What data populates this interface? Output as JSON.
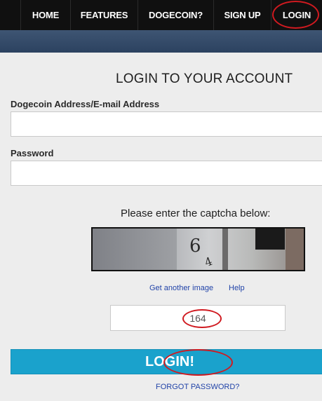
{
  "nav": {
    "items": [
      {
        "label": "HOME"
      },
      {
        "label": "FEATURES"
      },
      {
        "label": "DOGECOIN?"
      },
      {
        "label": "SIGN UP"
      },
      {
        "label": "LOGIN"
      }
    ]
  },
  "form": {
    "title": "LOGIN TO YOUR ACCOUNT",
    "address_label": "Dogecoin Address/E-mail Address",
    "address_value": "",
    "password_label": "Password",
    "password_value": "",
    "captcha_prompt": "Please enter the captcha below:",
    "captcha_glyphs": [
      "6",
      "4"
    ],
    "get_another_image": "Get another image",
    "help": "Help",
    "captcha_value": "164",
    "login_button": "LOGIN!",
    "forgot_password": "FORGOT PASSWORD?"
  },
  "colors": {
    "nav_background": "#101010",
    "band": "#34496a",
    "button": "#1aa2cc",
    "highlight_ring": "#d01a20",
    "link": "#2143a8"
  }
}
